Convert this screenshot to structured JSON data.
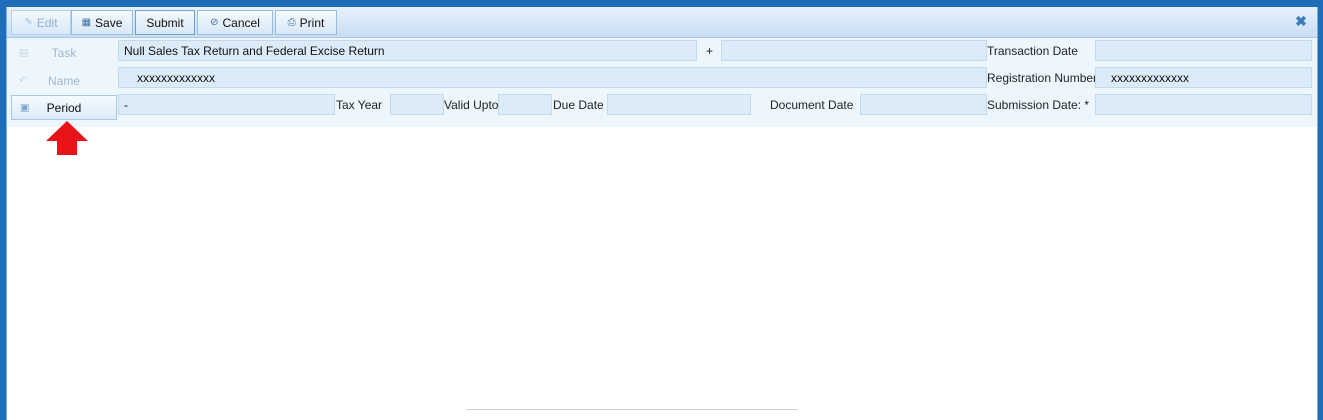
{
  "toolbar": {
    "edit_label": "Edit",
    "save_label": "Save",
    "submit_label": "Submit",
    "cancel_label": "Cancel",
    "print_label": "Print"
  },
  "side": {
    "task_label": "Task",
    "name_label": "Name",
    "period_label": "Period"
  },
  "form": {
    "task_value": "Null Sales Tax Return and Federal Excise Return",
    "plus_label": "+",
    "extra_value": "",
    "name_value": "xxxxxxxxxxxxx",
    "period_value": "-",
    "tax_year_label": "Tax Year",
    "tax_year_value": "",
    "valid_upto_label": "Valid Upto",
    "valid_upto_value": "",
    "due_date_label": "Due Date",
    "due_date_value": "",
    "document_date_label": "Document Date",
    "document_date_value": "",
    "transaction_date_label": "Transaction Date",
    "transaction_date_value": "",
    "registration_number_label": "Registration Number",
    "registration_number_value": "xxxxxxxxxxxxx",
    "submission_date_label": "Submission Date: *",
    "submission_date_value": ""
  },
  "colors": {
    "frame": "#1f6db8",
    "field_bg": "#dcebf8",
    "arrow": "#e8141a"
  }
}
